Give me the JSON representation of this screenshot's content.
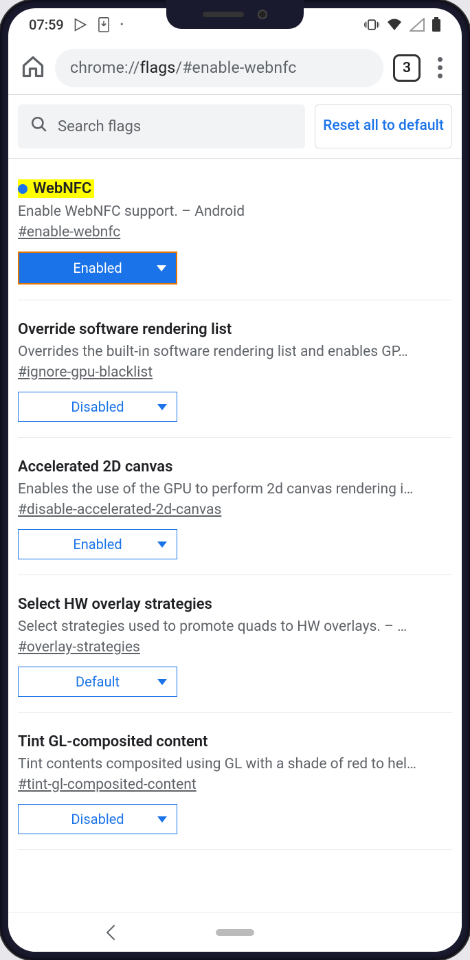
{
  "status": {
    "time": "07:59"
  },
  "chrome": {
    "url_prefix": "chrome://",
    "url_dark": "flags",
    "url_suffix": "/#enable-webnfc",
    "tab_count": "3"
  },
  "toolbar": {
    "search_placeholder": "Search flags",
    "reset_label": "Reset all to default"
  },
  "flags": [
    {
      "title": "WebNFC",
      "highlighted": true,
      "dot": true,
      "desc": "Enable WebNFC support. – Android",
      "hash": "#enable-webnfc",
      "value": "Enabled",
      "active": true
    },
    {
      "title": "Override software rendering list",
      "desc": "Overrides the built-in software rendering list and enables GP…",
      "hash": "#ignore-gpu-blacklist",
      "value": "Disabled"
    },
    {
      "title": "Accelerated 2D canvas",
      "desc": "Enables the use of the GPU to perform 2d canvas rendering i…",
      "hash": "#disable-accelerated-2d-canvas",
      "value": "Enabled"
    },
    {
      "title": "Select HW overlay strategies",
      "desc": "Select strategies used to promote quads to HW overlays. – …",
      "hash": "#overlay-strategies",
      "value": "Default"
    },
    {
      "title": "Tint GL-composited content",
      "desc": "Tint contents composited using GL with a shade of red to hel…",
      "hash": "#tint-gl-composited-content",
      "value": "Disabled"
    }
  ]
}
